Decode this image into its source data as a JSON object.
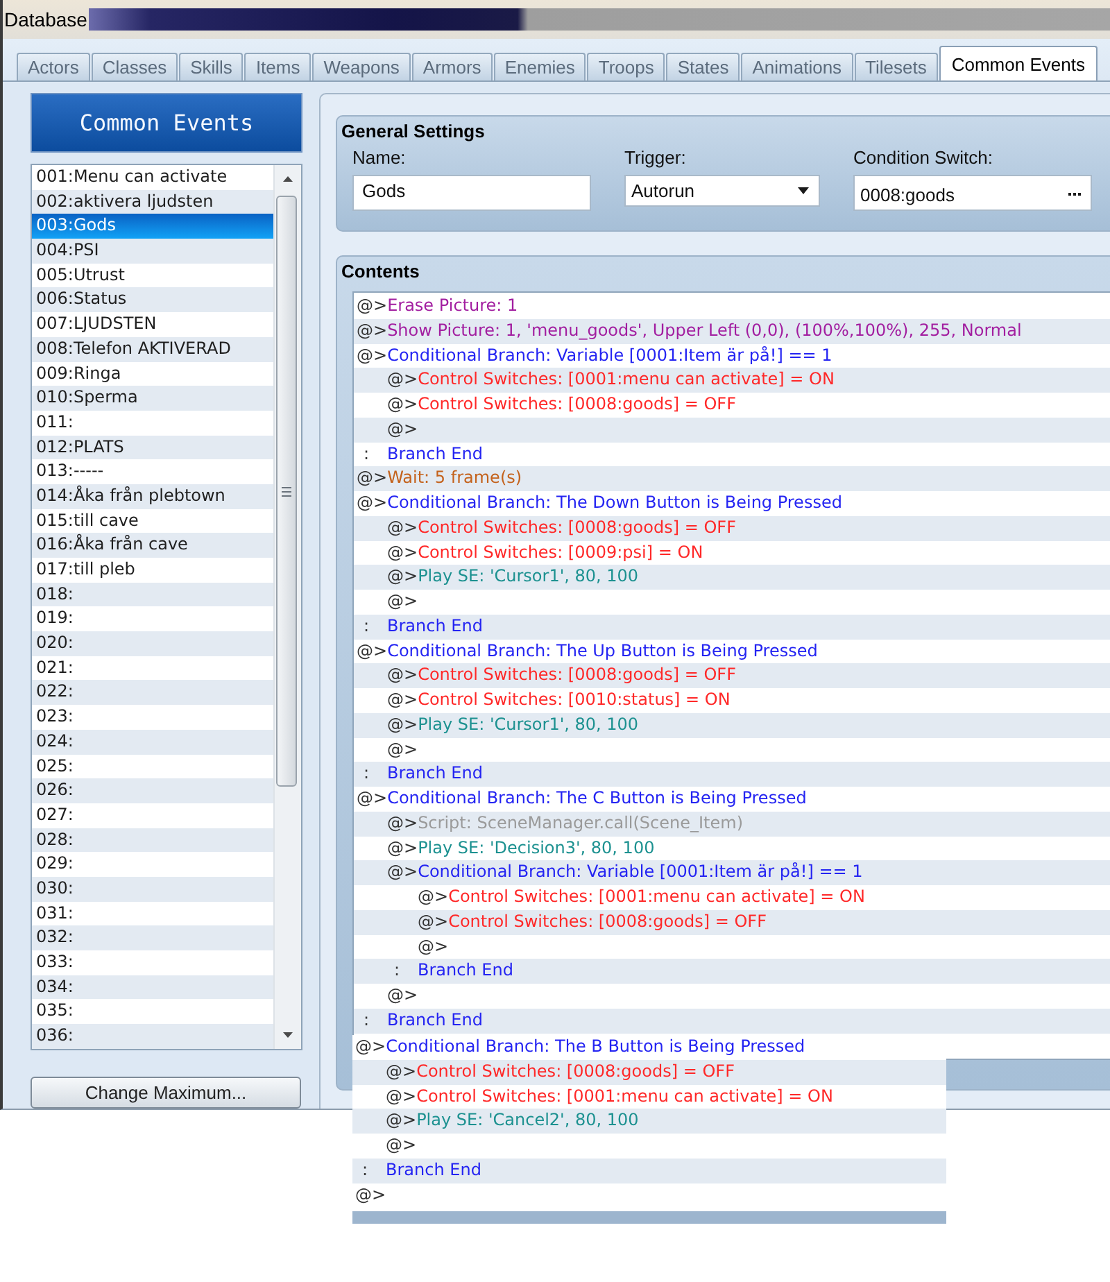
{
  "window": {
    "title": "Database"
  },
  "tabs": [
    {
      "label": "Actors",
      "selected": false
    },
    {
      "label": "Classes",
      "selected": false
    },
    {
      "label": "Skills",
      "selected": false
    },
    {
      "label": "Items",
      "selected": false
    },
    {
      "label": "Weapons",
      "selected": false
    },
    {
      "label": "Armors",
      "selected": false
    },
    {
      "label": "Enemies",
      "selected": false
    },
    {
      "label": "Troops",
      "selected": false
    },
    {
      "label": "States",
      "selected": false
    },
    {
      "label": "Animations",
      "selected": false
    },
    {
      "label": "Tilesets",
      "selected": false
    },
    {
      "label": "Common Events",
      "selected": true
    }
  ],
  "event_list": {
    "title": "Common Events",
    "items": [
      {
        "label": "001:Menu can activate",
        "selected": false
      },
      {
        "label": "002:aktivera ljudsten",
        "selected": false
      },
      {
        "label": "003:Gods",
        "selected": true
      },
      {
        "label": "004:PSI",
        "selected": false
      },
      {
        "label": "005:Utrust",
        "selected": false
      },
      {
        "label": "006:Status",
        "selected": false
      },
      {
        "label": "007:LJUDSTEN",
        "selected": false
      },
      {
        "label": "008:Telefon AKTIVERAD",
        "selected": false
      },
      {
        "label": "009:Ringa",
        "selected": false
      },
      {
        "label": "010:Sperma",
        "selected": false
      },
      {
        "label": "011:",
        "selected": false
      },
      {
        "label": "012:PLATS",
        "selected": false
      },
      {
        "label": "013:-----",
        "selected": false
      },
      {
        "label": "014:Åka från plebtown",
        "selected": false
      },
      {
        "label": "015:till cave",
        "selected": false
      },
      {
        "label": "016:Åka från cave",
        "selected": false
      },
      {
        "label": "017:till pleb",
        "selected": false
      },
      {
        "label": "018:",
        "selected": false
      },
      {
        "label": "019:",
        "selected": false
      },
      {
        "label": "020:",
        "selected": false
      },
      {
        "label": "021:",
        "selected": false
      },
      {
        "label": "022:",
        "selected": false
      },
      {
        "label": "023:",
        "selected": false
      },
      {
        "label": "024:",
        "selected": false
      },
      {
        "label": "025:",
        "selected": false
      },
      {
        "label": "026:",
        "selected": false
      },
      {
        "label": "027:",
        "selected": false
      },
      {
        "label": "028:",
        "selected": false
      },
      {
        "label": "029:",
        "selected": false
      },
      {
        "label": "030:",
        "selected": false
      },
      {
        "label": "031:",
        "selected": false
      },
      {
        "label": "032:",
        "selected": false
      },
      {
        "label": "033:",
        "selected": false
      },
      {
        "label": "034:",
        "selected": false
      },
      {
        "label": "035:",
        "selected": false
      },
      {
        "label": "036:",
        "selected": false
      }
    ],
    "button": "Change Maximum..."
  },
  "general_settings": {
    "title": "General Settings",
    "name": {
      "label": "Name:",
      "value": "Gods"
    },
    "trigger": {
      "label": "Trigger:",
      "value": "Autorun"
    },
    "condition_switch": {
      "label": "Condition Switch:",
      "value": "0008:goods"
    }
  },
  "contents": {
    "title": "Contents",
    "commands": [
      {
        "kind": "picture",
        "marker": "@>",
        "text": "Erase Picture: 1"
      },
      {
        "kind": "picture",
        "marker": "@>",
        "text": "Show Picture: 1, 'menu_goods', Upper Left (0,0), (100%,100%), 255, Normal"
      },
      {
        "kind": "branch",
        "marker": "@>",
        "text": "Conditional Branch: Variable [0001:Item är på!] == 1",
        "children": [
          {
            "kind": "switch",
            "marker": "@>",
            "text": "Control Switches: [0001:menu can activate] = ON"
          },
          {
            "kind": "switch",
            "marker": "@>",
            "text": "Control Switches: [0008:goods] = OFF"
          },
          {
            "kind": "empty",
            "marker": "@>"
          }
        ],
        "end": {
          "marker": ":",
          "text": "Branch End"
        }
      },
      {
        "kind": "wait",
        "marker": "@>",
        "text": "Wait: 5 frame(s)"
      },
      {
        "kind": "branch",
        "marker": "@>",
        "text": "Conditional Branch: The Down Button is Being Pressed",
        "children": [
          {
            "kind": "switch",
            "marker": "@>",
            "text": "Control Switches: [0008:goods] = OFF"
          },
          {
            "kind": "switch",
            "marker": "@>",
            "text": "Control Switches: [0009:psi] = ON"
          },
          {
            "kind": "sound",
            "marker": "@>",
            "text": "Play SE: 'Cursor1', 80, 100"
          },
          {
            "kind": "empty",
            "marker": "@>"
          }
        ],
        "end": {
          "marker": ":",
          "text": "Branch End"
        }
      },
      {
        "kind": "branch",
        "marker": "@>",
        "text": "Conditional Branch: The Up Button is Being Pressed",
        "children": [
          {
            "kind": "switch",
            "marker": "@>",
            "text": "Control Switches: [0008:goods] = OFF"
          },
          {
            "kind": "switch",
            "marker": "@>",
            "text": "Control Switches: [0010:status] = ON"
          },
          {
            "kind": "sound",
            "marker": "@>",
            "text": "Play SE: 'Cursor1', 80, 100"
          },
          {
            "kind": "empty",
            "marker": "@>"
          }
        ],
        "end": {
          "marker": ":",
          "text": "Branch End"
        }
      },
      {
        "kind": "branch",
        "marker": "@>",
        "text": "Conditional Branch: The C Button is Being Pressed",
        "children": [
          {
            "kind": "script",
            "marker": "@>",
            "text": "Script: SceneManager.call(Scene_Item)"
          },
          {
            "kind": "sound",
            "marker": "@>",
            "text": "Play SE: 'Decision3', 80, 100"
          },
          {
            "kind": "branch",
            "marker": "@>",
            "text": "Conditional Branch: Variable [0001:Item är på!] == 1",
            "children": [
              {
                "kind": "switch",
                "marker": "@>",
                "text": "Control Switches: [0001:menu can activate] = ON"
              },
              {
                "kind": "switch",
                "marker": "@>",
                "text": "Control Switches: [0008:goods] = OFF"
              },
              {
                "kind": "empty",
                "marker": "@>"
              }
            ],
            "end": {
              "marker": ":",
              "text": "Branch End"
            }
          },
          {
            "kind": "empty",
            "marker": "@>"
          }
        ],
        "end": {
          "marker": ":",
          "text": "Branch End"
        }
      }
    ]
  },
  "continuation": {
    "commands": [
      {
        "kind": "branch",
        "marker": "@>",
        "text": "Conditional Branch: The B Button is Being Pressed",
        "children": [
          {
            "kind": "switch",
            "marker": "@>",
            "text": "Control Switches: [0008:goods] = OFF"
          },
          {
            "kind": "switch",
            "marker": "@>",
            "text": "Control Switches: [0001:menu can activate] = ON"
          },
          {
            "kind": "sound",
            "marker": "@>",
            "text": "Play SE: 'Cancel2', 80, 100"
          },
          {
            "kind": "empty",
            "marker": "@>"
          }
        ],
        "end": {
          "marker": ":",
          "text": "Branch End"
        }
      },
      {
        "kind": "empty",
        "marker": "@>"
      }
    ]
  }
}
